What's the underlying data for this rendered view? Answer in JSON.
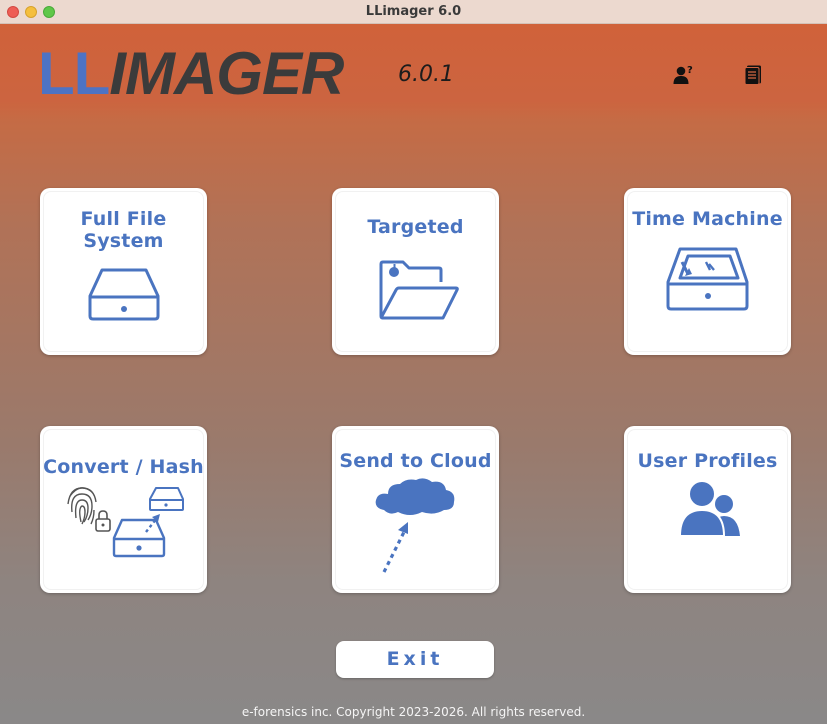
{
  "window": {
    "title": "LLimager 6.0"
  },
  "header": {
    "logo_ll": "LL",
    "logo_imager": "IMAGER",
    "version": "6.0.1",
    "icons": [
      "user-help-icon",
      "manual-icon"
    ]
  },
  "tiles": [
    {
      "label": "Full File System",
      "icon": "drive-icon"
    },
    {
      "label": "Targeted",
      "icon": "folder-icon"
    },
    {
      "label": "Time Machine",
      "icon": "time-machine-icon"
    },
    {
      "label": "Convert / Hash",
      "icon": "convert-hash-icon"
    },
    {
      "label": "Send to Cloud",
      "icon": "cloud-upload-icon"
    },
    {
      "label": "User Profiles",
      "icon": "users-icon"
    }
  ],
  "exit_label": "Exit",
  "footer": "e-forensics inc. Copyright 2023-2026. All rights reserved.",
  "colors": {
    "accent": "#4a74c0",
    "header": "#cf613a",
    "logo_dark": "#3b3b3b"
  }
}
